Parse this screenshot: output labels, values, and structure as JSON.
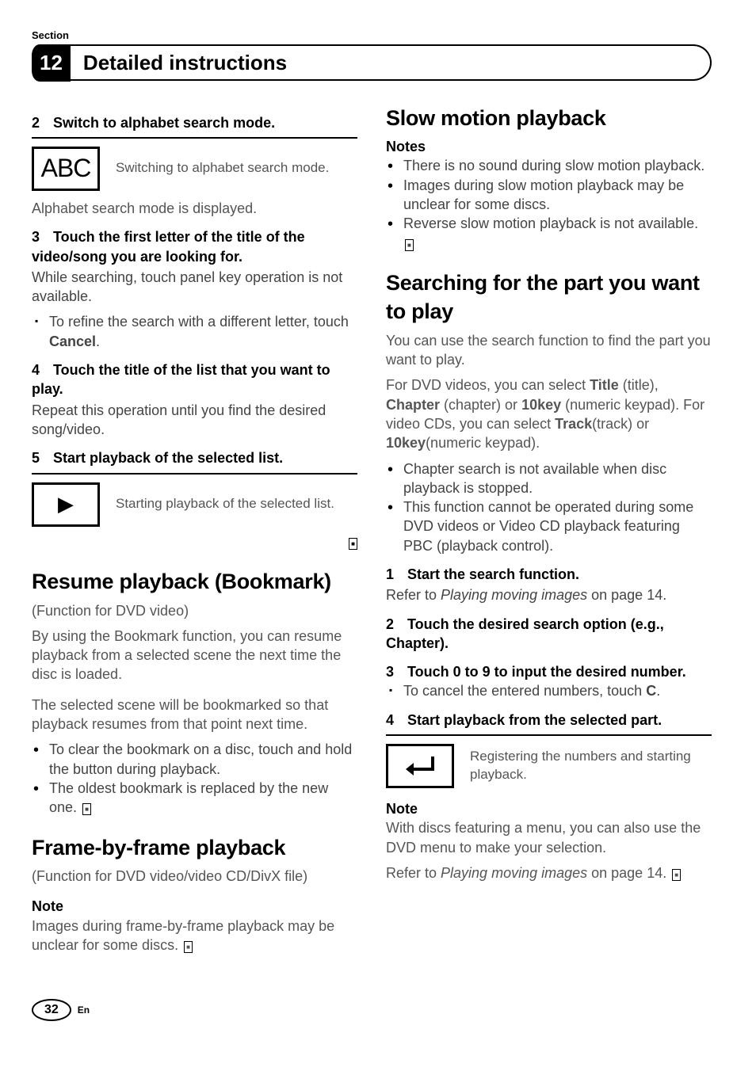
{
  "header": {
    "section_label": "Section",
    "section_number": "12",
    "title": "Detailed instructions"
  },
  "left": {
    "step2": {
      "num": "2",
      "title": "Switch to alphabet search mode."
    },
    "abc_icon_label": "ABC",
    "abc_icon_desc": "Switching to alphabet search mode.",
    "after_abc": "Alphabet search mode is displayed.",
    "step3": {
      "num": "3",
      "title": "Touch the first letter of the title of the video/song you are looking for."
    },
    "step3_desc": "While searching, touch panel key operation is not available.",
    "step3_sub": "To refine the search with a different letter, touch ",
    "step3_sub_bold": "Cancel",
    "step3_sub_tail": ".",
    "step4": {
      "num": "4",
      "title": "Touch the title of the list that you want to play."
    },
    "step4_desc": "Repeat this operation until you find the desired song/video.",
    "step5": {
      "num": "5",
      "title": "Start playback of the selected list."
    },
    "play_icon_desc": "Starting playback of the selected list.",
    "resume_h2": "Resume playback (Bookmark)",
    "resume_sub": "(Function for DVD video)",
    "resume_p1": "By using the Bookmark function, you can resume playback from a selected scene the next time the disc is loaded.",
    "resume_p2": "The selected scene will be bookmarked so that playback resumes from that point next time.",
    "resume_b1": "To clear the bookmark on a disc, touch and hold the button during playback.",
    "resume_b2": "The oldest bookmark is replaced by the new one.",
    "frame_h2": "Frame-by-frame playback",
    "frame_sub": "(Function for DVD video/video CD/DivX file)",
    "frame_note_label": "Note",
    "frame_note": "Images during frame-by-frame playback may be unclear for some discs."
  },
  "right": {
    "slow_h2": "Slow motion playback",
    "notes_label": "Notes",
    "slow_b1": "There is no sound during slow motion playback.",
    "slow_b2": "Images during slow motion playback may be unclear for some discs.",
    "slow_b3": "Reverse slow motion playback is not available.",
    "search_h2": "Searching for the part you want to play",
    "search_p1": "You can use the search function to find the part you want to play.",
    "search_p2a": "For DVD videos, you can select ",
    "search_p2_title": "Title",
    "search_p2b": " (title), ",
    "search_p2_chapter": "Chapter",
    "search_p2c": " (chapter) or ",
    "search_p2_10key": "10key",
    "search_p2d": " (numeric keypad). For video CDs, you can select ",
    "search_p2_track": "Track",
    "search_p2e": "(track) or ",
    "search_p2_10key2": "10key",
    "search_p2f": "(numeric keypad).",
    "search_b1": "Chapter search is not available when disc playback is stopped.",
    "search_b2": "This function cannot be operated during some DVD videos or Video CD playback featuring PBC (playback control).",
    "sstep1": {
      "num": "1",
      "title": "Start the search function."
    },
    "sstep1_desc_a": "Refer to ",
    "sstep1_desc_i": "Playing moving images",
    "sstep1_desc_b": " on page 14.",
    "sstep2": {
      "num": "2",
      "title": "Touch the desired search option (e.g., Chapter)."
    },
    "sstep3": {
      "num": "3",
      "title": "Touch 0 to 9 to input the desired number."
    },
    "sstep3_sub_a": "To cancel the entered numbers, touch ",
    "sstep3_sub_bold": "C",
    "sstep3_sub_b": ".",
    "sstep4": {
      "num": "4",
      "title": "Start playback from the selected part."
    },
    "enter_icon_desc": "Registering the numbers and starting playback.",
    "endnote_label": "Note",
    "endnote_p1": "With discs featuring a menu, you can also use the DVD menu to make your selection.",
    "endnote_p2a": "Refer to ",
    "endnote_p2i": "Playing moving images",
    "endnote_p2b": " on page 14."
  },
  "footer": {
    "page": "32",
    "lang": "En"
  }
}
